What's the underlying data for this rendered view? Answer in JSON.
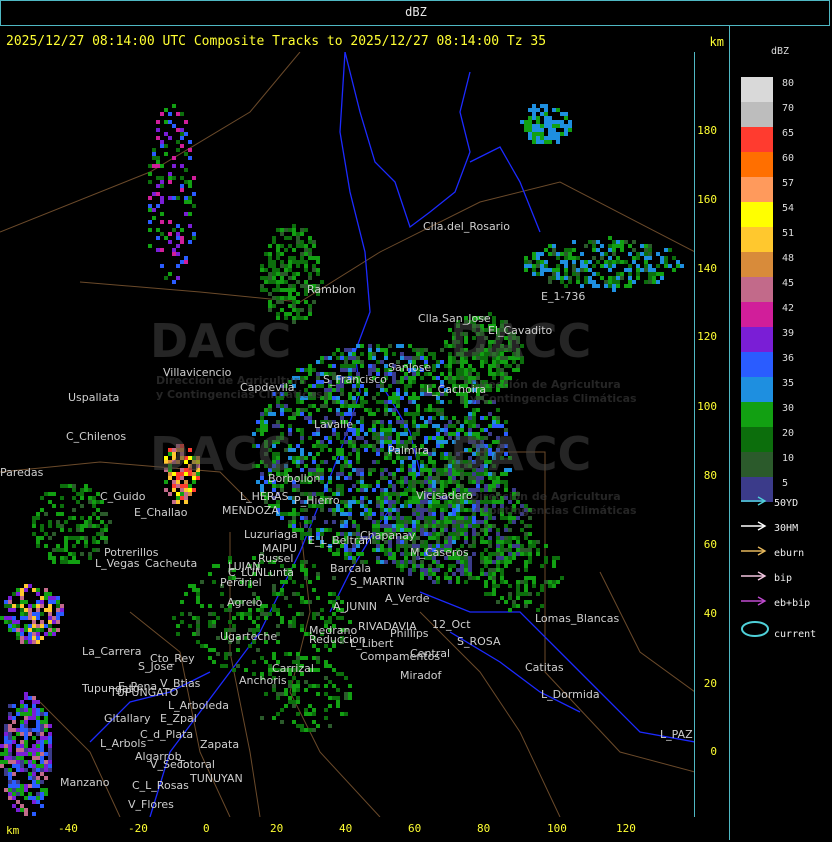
{
  "top_bar": {
    "unit_label": "dBZ"
  },
  "header": {
    "title": "2025/12/27 08:14:00 UTC Composite Tracks to 2025/12/27 08:14:00 Tz 35",
    "km_label": "km"
  },
  "axes": {
    "y_ticks": [
      "180",
      "160",
      "140",
      "120",
      "100",
      "80",
      "60",
      "40",
      "20",
      "0"
    ],
    "x_ticks": [
      "-40",
      "-20",
      "0",
      "20",
      "40",
      "60",
      "80",
      "100",
      "120"
    ],
    "x_unit": "km"
  },
  "watermark": {
    "brand": "DACC",
    "line1": "Dirección de Agricultura",
    "line2": "y Contingencias Climáticas"
  },
  "places": [
    "Clla.del_Rosario",
    "Ramblon",
    "E_1-736",
    "Clla.San_Jose",
    "El_Cavadito",
    "Villavicencio",
    "Capdevila",
    "S_Francisco",
    "SanJose",
    "L_Cachoira",
    "Uspallata",
    "C_Chilenos",
    "Paredas",
    "Lavalle",
    "Borbollon",
    "L_HERAS",
    "P_Hierro",
    "MENDOZA",
    "Palmira",
    "Vicisadero",
    "C_Guido",
    "E_Challao",
    "Luzuriaga",
    "MAIPU",
    "Russel",
    "E_L_Beltran",
    "Chapanay",
    "Potrerillos",
    "L_Vegas",
    "Cacheuta",
    "LUJAN",
    "C_LUNLunta",
    "Perdriel",
    "Barcala",
    "S_MARTIN",
    "M_Caseros",
    "Agrelo",
    "A_Verde",
    "A_JUNIN",
    "Ugarteche",
    "La_Carrera",
    "Cto_Rey",
    "S_Jose",
    "Medrano",
    "Reduccion",
    "RIVADAVIA",
    "Phillips",
    "12_Oct",
    "S_ROSA",
    "Lomas_Blancas",
    "L_Libert",
    "Compamentos",
    "Carrizal",
    "Central",
    "Catitas",
    "E_Pena",
    "Anchoris",
    "V_Btias",
    "TUPUNGATO",
    "L_Arboleda",
    "Miradof",
    "L_Dormida",
    "Gltallary",
    "E_Zpal",
    "C_d_Plata",
    "L_Arbols",
    "Algarrob",
    "V_Seco",
    "Zapata",
    "Totoral",
    "TUNUYAN",
    "Manzano",
    "C_L_Rosas",
    "V_Flores",
    "L_PAZ",
    "Tupungato"
  ],
  "color_scale": {
    "title": "dBZ",
    "levels": [
      {
        "value": "80",
        "color": "#d9d9d9"
      },
      {
        "value": "70",
        "color": "#bdbdbd"
      },
      {
        "value": "65",
        "color": "#ff3b2f"
      },
      {
        "value": "60",
        "color": "#ff6f00"
      },
      {
        "value": "57",
        "color": "#ff9a5c"
      },
      {
        "value": "54",
        "color": "#ffff00"
      },
      {
        "value": "51",
        "color": "#ffc82e"
      },
      {
        "value": "48",
        "color": "#d88b3a"
      },
      {
        "value": "45",
        "color": "#c26a8a"
      },
      {
        "value": "42",
        "color": "#d11e9a"
      },
      {
        "value": "39",
        "color": "#7a1ed6"
      },
      {
        "value": "36",
        "color": "#2a5cff"
      },
      {
        "value": "35",
        "color": "#1e8fe0"
      },
      {
        "value": "30",
        "color": "#12a012"
      },
      {
        "value": "20",
        "color": "#0c6e0c"
      },
      {
        "value": "10",
        "color": "#2b5a2b"
      },
      {
        "value": "5",
        "color": "#3b3b8a"
      }
    ]
  },
  "track_legend": [
    {
      "label": "50YD",
      "color": "#4fd1d9"
    },
    {
      "label": "30HM",
      "color": "#ffffff"
    },
    {
      "label": "eburn",
      "color": "#e6b85c"
    },
    {
      "label": "bip",
      "color": "#f2c6e0"
    },
    {
      "label": "eb+bip",
      "color": "#c04bd0"
    },
    {
      "label": "current",
      "color": "#4fd1d9"
    }
  ]
}
